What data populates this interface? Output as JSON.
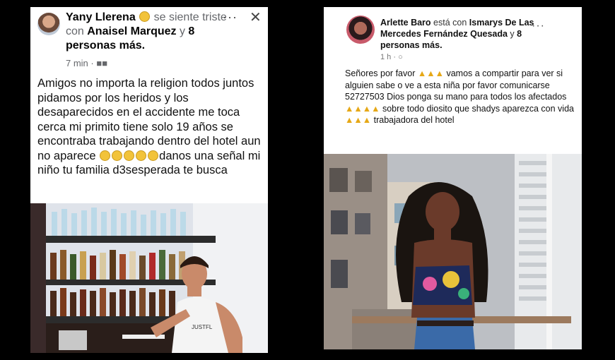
{
  "post1": {
    "author": "Yany Llerena",
    "feeling": "se siente triste con",
    "tagged": "Anaisel Marquez",
    "joiner": "y",
    "others": "8 personas más.",
    "time": "7 min ·",
    "text_a": "Amigos no importa la religion todos juntos pidamos por los heridos y los desaparecidos en el accidente me toca cerca mi primito tiene solo 19 años se encontraba trabajando dentro del hotel aun no aparece",
    "text_b": "danos una señal mi niño tu familia d3sesperada te busca",
    "shirt_text": "JUSTFL"
  },
  "post2": {
    "author": "Arlette Baro",
    "joiner": "está con",
    "tagged": "Ismarys De Las Mercedes Fernández Quesada",
    "and": "y",
    "others": "8 personas más.",
    "time": "1 h ·",
    "text_1": "Señores por favor",
    "text_2": "vamos a compartir para ver si alguien sabe o ve a esta niña por favor comunicarse 52727503 Dios ponga su mano para todos los afectados",
    "text_3": "sobre todo diosito que shadys aparezca con vida",
    "text_4": "trabajadora del hotel"
  },
  "icons": {
    "menu": "more-dots-icon",
    "close": "close-icon",
    "audience": "audience-icon",
    "emoji_sad": "sad-face-icon",
    "pray": "praying-hands-icon"
  }
}
